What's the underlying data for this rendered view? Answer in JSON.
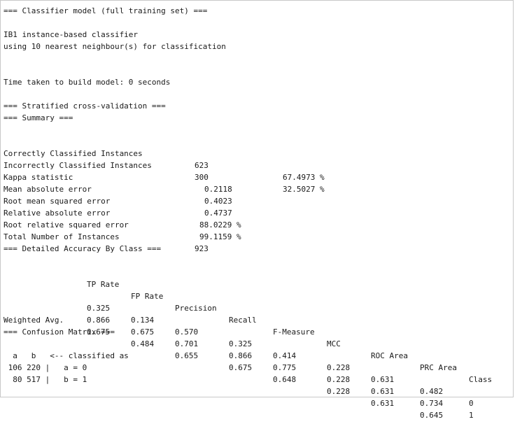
{
  "header": {
    "model_title": "=== Classifier model (full training set) ===",
    "classifier_name": "IB1 instance-based classifier",
    "classifier_desc": "using 10 nearest neighbour(s) for classification",
    "time_taken": "Time taken to build model: 0 seconds"
  },
  "cv": {
    "title": "=== Stratified cross-validation ===",
    "summary_title": "=== Summary ==="
  },
  "summary": [
    {
      "label": "Correctly Classified Instances",
      "value": "623",
      "pct": "67.4973 %"
    },
    {
      "label": "Incorrectly Classified Instances",
      "value": "300",
      "pct": "32.5027 %"
    },
    {
      "label": "Kappa statistic",
      "value": "0.2118",
      "pct": ""
    },
    {
      "label": "Mean absolute error",
      "value": "0.4023",
      "pct": ""
    },
    {
      "label": "Root mean squared error",
      "value": "0.4737",
      "pct": ""
    },
    {
      "label": "Relative absolute error",
      "value": "88.0229 %",
      "pct": ""
    },
    {
      "label": "Root relative squared error",
      "value": "99.1159 %",
      "pct": ""
    },
    {
      "label": "Total Number of Instances",
      "value": "923",
      "pct": ""
    }
  ],
  "accuracy": {
    "title": "=== Detailed Accuracy By Class ===",
    "headers": [
      "TP Rate",
      "FP Rate",
      "Precision",
      "Recall",
      "F-Measure",
      "MCC",
      "ROC Area",
      "PRC Area",
      "Class"
    ],
    "rows": [
      {
        "label": "",
        "cells": [
          "0.325",
          "0.134",
          "0.570",
          "0.325",
          "0.414",
          "0.228",
          "0.631",
          "0.482",
          "0"
        ]
      },
      {
        "label": "",
        "cells": [
          "0.866",
          "0.675",
          "0.701",
          "0.866",
          "0.775",
          "0.228",
          "0.631",
          "0.734",
          "1"
        ]
      },
      {
        "label": "Weighted Avg.",
        "cells": [
          "0.675",
          "0.484",
          "0.655",
          "0.675",
          "0.648",
          "0.228",
          "0.631",
          "0.645",
          ""
        ]
      }
    ]
  },
  "confusion": {
    "title": "=== Confusion Matrix ===",
    "header": "  a   b   <-- classified as",
    "rows": [
      " 106 220 |   a = 0",
      "  80 517 |   b = 1"
    ]
  }
}
